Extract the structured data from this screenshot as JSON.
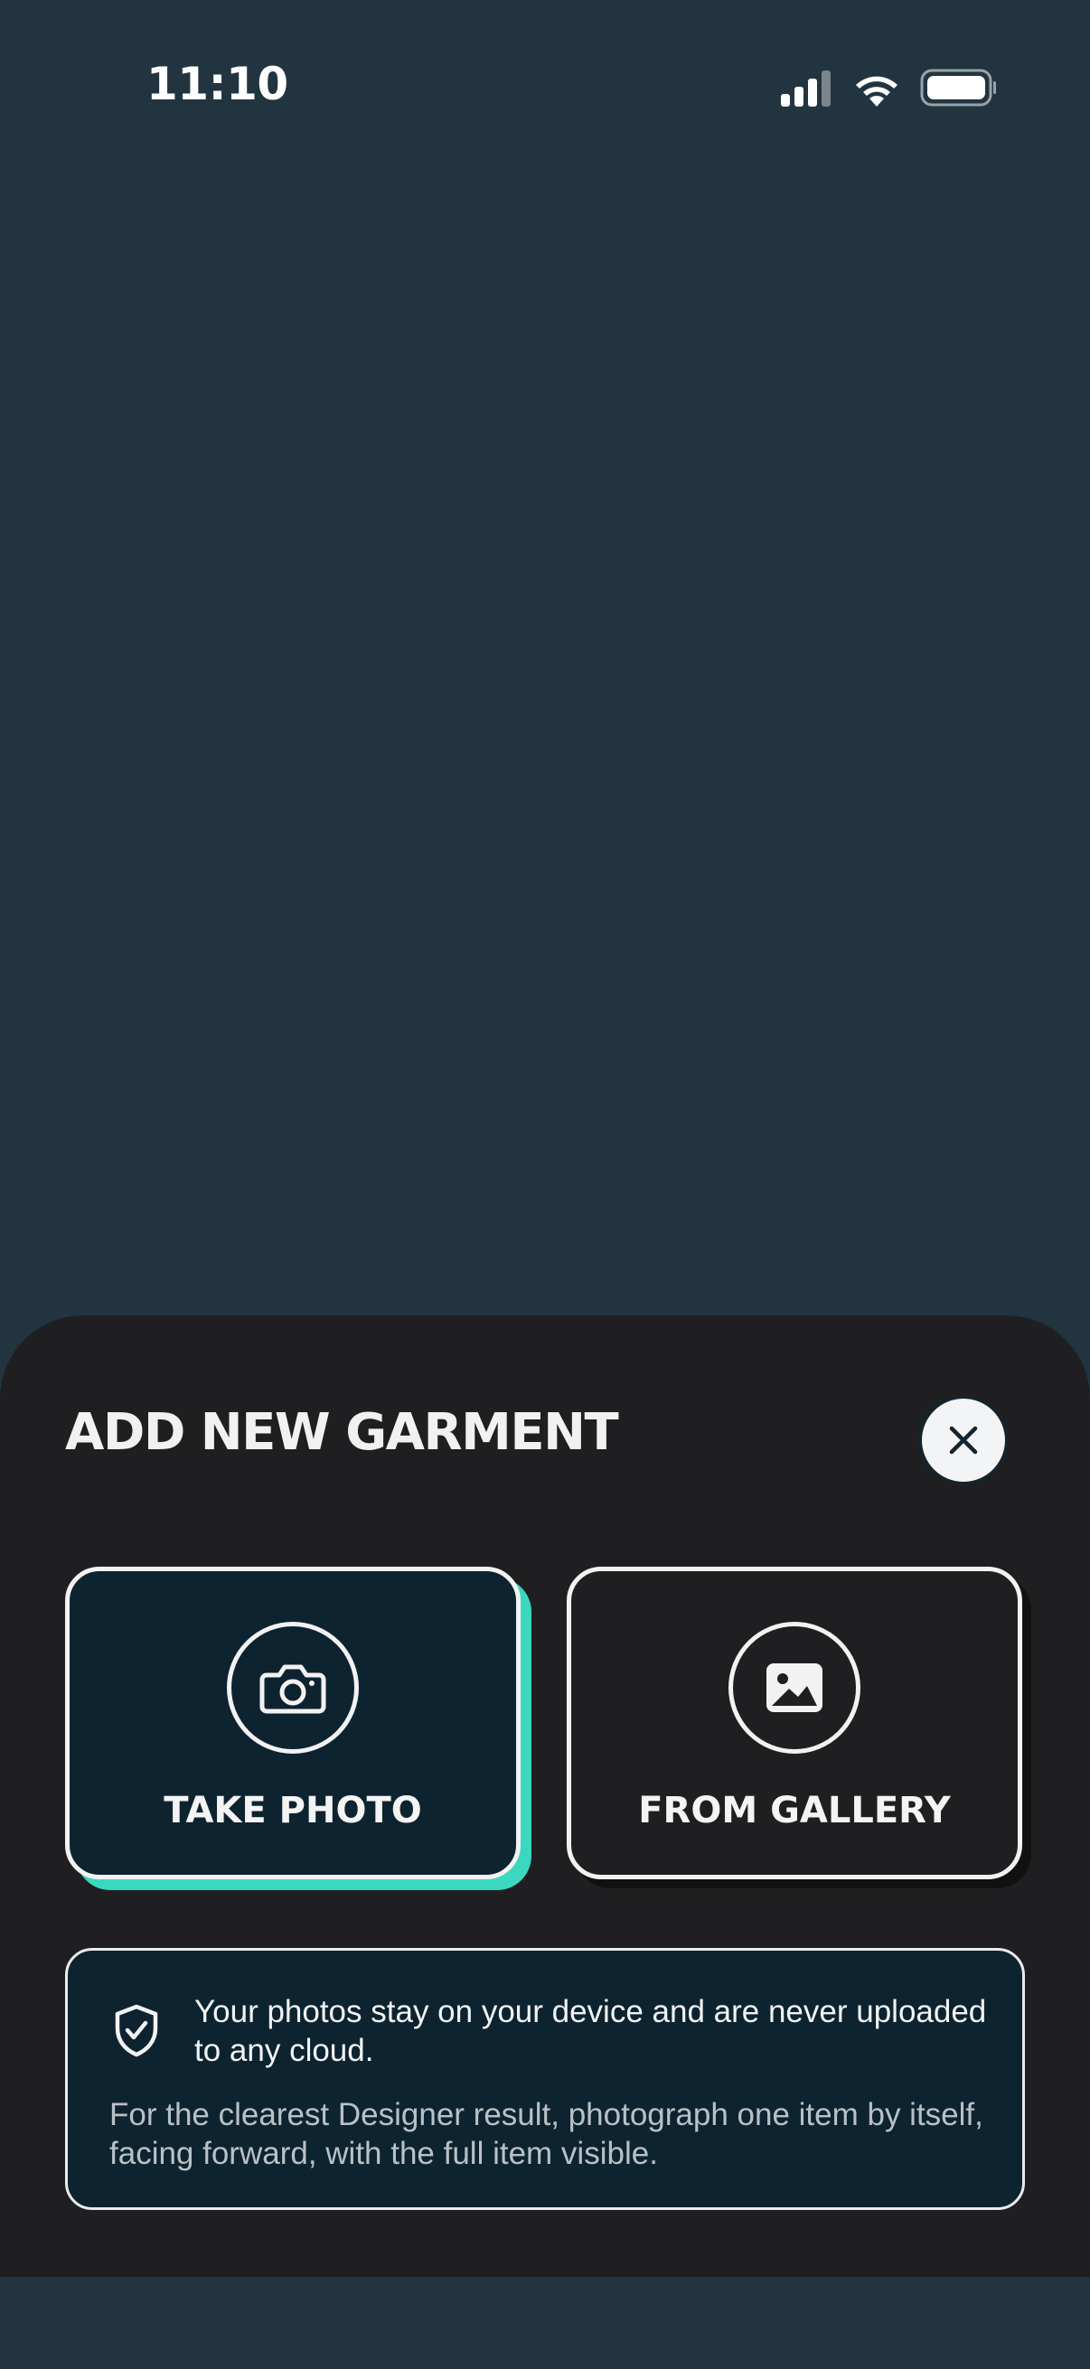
{
  "status_bar": {
    "time": "11:10",
    "icons": [
      "cellular-signal-icon",
      "wifi-icon",
      "battery-icon"
    ]
  },
  "sheet": {
    "title": "ADD NEW GARMENT",
    "close_icon": "close-icon",
    "options": [
      {
        "label": "TAKE PHOTO",
        "icon": "camera-icon",
        "selected": true
      },
      {
        "label": "FROM GALLERY",
        "icon": "image-icon",
        "selected": false
      }
    ],
    "info": {
      "icon": "shield-check-icon",
      "privacy": "Your photos stay on your device and are never uploaded to any cloud.",
      "tip": "For the clearest Designer result, photograph one item by itself, facing forward, with the full item visible."
    }
  },
  "colors": {
    "background": "#213440",
    "sheet": "#1f1f21",
    "card_dark": "#0e2330",
    "accent": "#3bd8bf"
  }
}
